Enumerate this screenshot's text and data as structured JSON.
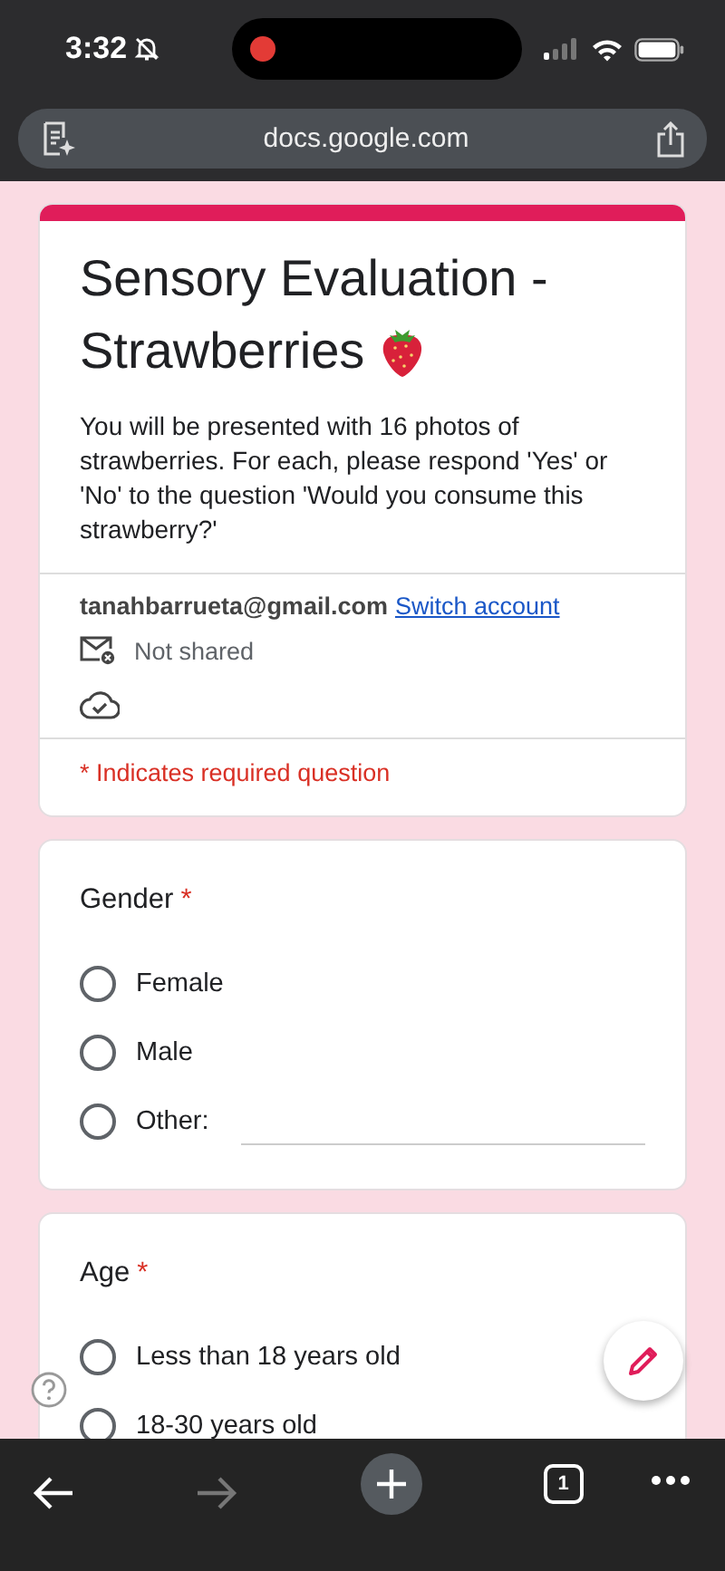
{
  "status_bar": {
    "time": "3:32",
    "silenced": true,
    "recording": true
  },
  "address_bar": {
    "url": "docs.google.com"
  },
  "form": {
    "title_lines": [
      "Sensory Evaluation -",
      "Strawberries"
    ],
    "description": "You will be presented with 16 photos of strawberries. For each, please respond 'Yes' or 'No' to the question 'Would you consume this strawberry?'",
    "account": {
      "email": "tanahbarrueta@gmail.com",
      "switch_link": "Switch account",
      "sharing": "Not shared"
    },
    "required_note": "* Indicates required question",
    "questions": [
      {
        "title": "Gender",
        "required": true,
        "required_mark": "*",
        "options": [
          {
            "label": "Female",
            "selected": false,
            "kind": "radio"
          },
          {
            "label": "Male",
            "selected": false,
            "kind": "radio"
          },
          {
            "label": "Other:",
            "selected": false,
            "kind": "other"
          }
        ]
      },
      {
        "title": "Age",
        "required": true,
        "required_mark": "*",
        "options": [
          {
            "label": "Less than 18 years old",
            "selected": false,
            "kind": "radio"
          },
          {
            "label": "18-30 years old",
            "selected": false,
            "kind": "radio"
          }
        ]
      }
    ]
  },
  "toolbar": {
    "forward_disabled": true,
    "tab_count": "1"
  }
}
